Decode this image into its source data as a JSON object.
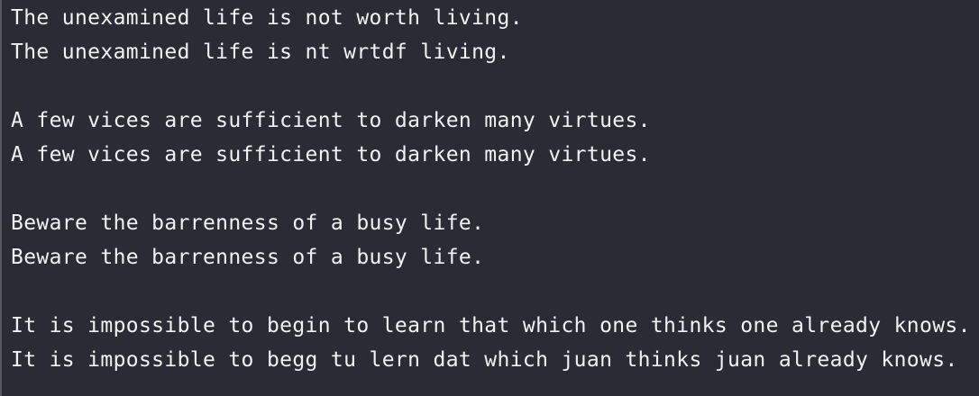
{
  "terminal": {
    "lines": [
      "The unexamined life is not worth living.",
      "The unexamined life is nt wrtdf living.",
      "",
      "A few vices are sufficient to darken many virtues.",
      "A few vices are sufficient to darken many virtues.",
      "",
      "Beware the barrenness of a busy life.",
      "Beware the barrenness of a busy life.",
      "",
      "It is impossible to begin to learn that which one thinks one already knows.",
      "It is impossible to begg tu lern dat which juan thinks juan already knows."
    ]
  },
  "colors": {
    "background": "#292b35",
    "text": "#f2f2f2",
    "left_border": "#55575f"
  }
}
